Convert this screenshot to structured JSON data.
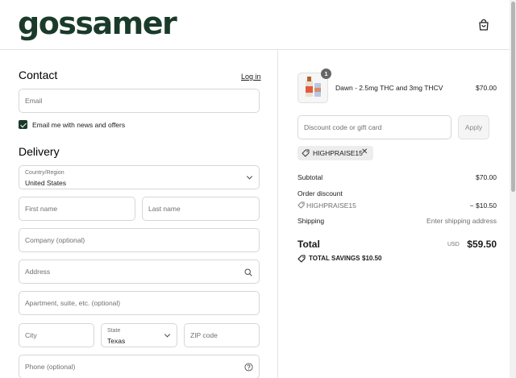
{
  "header": {
    "brand": "gossamer"
  },
  "contact": {
    "heading": "Contact",
    "login_link": "Log in",
    "email_placeholder": "Email",
    "newsletter_label": "Email me with news and offers",
    "newsletter_checked": true
  },
  "delivery": {
    "heading": "Delivery",
    "country_label": "Country/Region",
    "country_value": "United States",
    "first_name_placeholder": "First name",
    "last_name_placeholder": "Last name",
    "company_placeholder": "Company (optional)",
    "address_placeholder": "Address",
    "apartment_placeholder": "Apartment, suite, etc. (optional)",
    "city_placeholder": "City",
    "state_label": "State",
    "state_value": "Texas",
    "zip_placeholder": "ZIP code",
    "phone_placeholder": "Phone (optional)"
  },
  "summary": {
    "product": {
      "name": "Dawn - 2.5mg THC and 3mg THCV",
      "price": "$70.00",
      "quantity": "1"
    },
    "discount_placeholder": "Discount code or gift card",
    "apply_label": "Apply",
    "applied_code": "HIGHPRAISE15",
    "subtotal_label": "Subtotal",
    "subtotal_value": "$70.00",
    "order_discount_label": "Order discount",
    "discount_code": "HIGHPRAISE15",
    "discount_value": "− $10.50",
    "shipping_label": "Shipping",
    "shipping_value": "Enter shipping address",
    "total_label": "Total",
    "currency": "USD",
    "total_value": "$59.50",
    "savings_label": "TOTAL SAVINGS",
    "savings_value": "$10.50"
  },
  "colors": {
    "brand": "#1b3b2a",
    "border": "#d6d6d6"
  }
}
